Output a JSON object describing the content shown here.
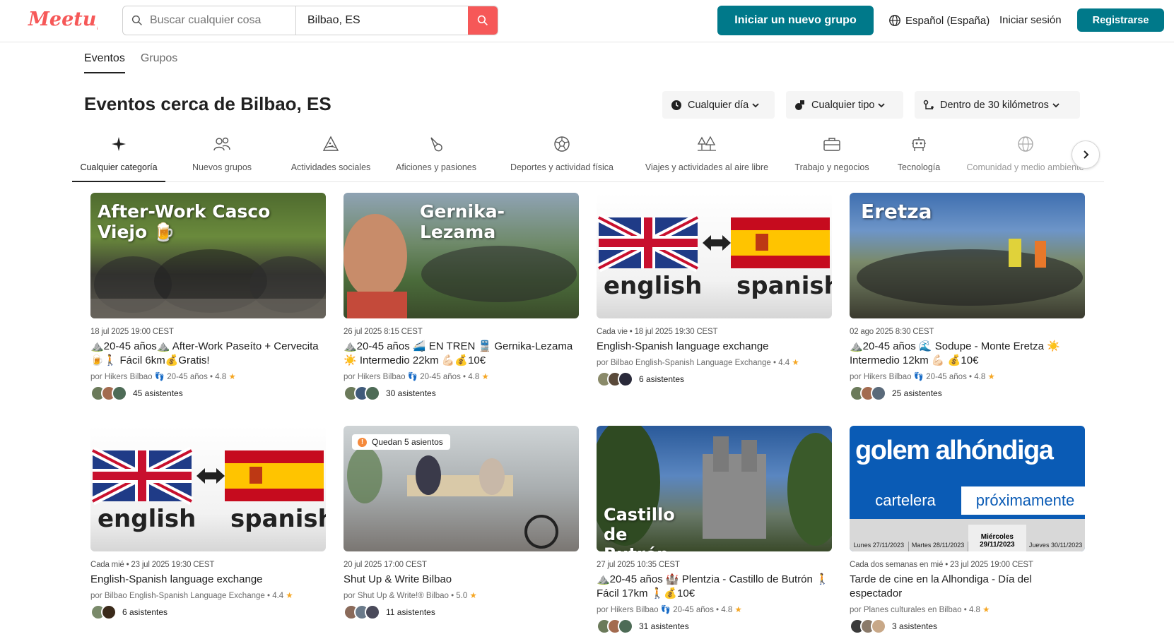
{
  "header": {
    "logo_text": "Meetup",
    "search_placeholder": "Buscar cualquier cosa",
    "location_value": "Bilbao, ES",
    "new_group_label": "Iniciar un nuevo grupo",
    "language_label": "Español (España)",
    "login_label": "Iniciar sesión",
    "register_label": "Registrarse",
    "colors": {
      "brand": "#f65858",
      "accent": "#00798a"
    }
  },
  "tabs": [
    {
      "label": "Eventos",
      "active": true
    },
    {
      "label": "Grupos",
      "active": false
    }
  ],
  "page_title": "Eventos cerca de Bilbao, ES",
  "filters": {
    "day": "Cualquier día",
    "type": "Cualquier tipo",
    "distance": "Dentro de 30 kilómetros"
  },
  "categories": [
    {
      "label": "Cualquier categoría",
      "icon": "sparkle-icon",
      "active": true
    },
    {
      "label": "Nuevos grupos",
      "icon": "people-icon"
    },
    {
      "label": "Actividades sociales",
      "icon": "pizza-icon"
    },
    {
      "label": "Aficiones y pasiones",
      "icon": "hobby-icon"
    },
    {
      "label": "Deportes y actividad física",
      "icon": "ball-icon"
    },
    {
      "label": "Viajes y actividades al aire libre",
      "icon": "trees-icon"
    },
    {
      "label": "Trabajo y negocios",
      "icon": "briefcase-icon"
    },
    {
      "label": "Tecnología",
      "icon": "robot-icon"
    },
    {
      "label": "Comunidad y medio ambiente",
      "icon": "globe-icon"
    }
  ],
  "events": [
    {
      "image_text": "After-Work Casco Viejo 🍺",
      "date": "18 jul 2025 19:00 CEST",
      "title": "⛰️20-45 años⛰️ After-Work Paseíto + Cervecita🍺🚶 Fácil 6km💰Gratis!",
      "org": "por Hikers Bilbao 👣 20-45 años • 4.8",
      "attendees": "45 asistentes"
    },
    {
      "image_text": "Gernika-Lezama",
      "date": "26 jul 2025 8:15 CEST",
      "title": "⛰️20-45 años 🚄 EN TREN 🚆 Gernika-Lezama ☀️ Intermedio 22km 💪🏻💰10€",
      "org": "por Hikers Bilbao 👣 20-45 años • 4.8",
      "attendees": "30 asistentes"
    },
    {
      "image_text_left": "english",
      "image_text_right": "spanish",
      "date": "Cada vie • 18 jul 2025 19:30 CEST",
      "title": "English-Spanish language exchange",
      "org": "por Bilbao English-Spanish Language Exchange • 4.4",
      "attendees": "6 asistentes"
    },
    {
      "image_text": "Eretza",
      "date": "02 ago 2025 8:30 CEST",
      "title": "⛰️20-45 años 🌊 Sodupe - Monte Eretza ☀️ Intermedio 12km 💪🏻 💰10€",
      "org": "por Hikers Bilbao 👣 20-45 años • 4.8",
      "attendees": "25 asistentes"
    },
    {
      "image_text_left": "english",
      "image_text_right": "spanish",
      "date": "Cada mié • 23 jul 2025 19:30 CEST",
      "title": "English-Spanish language exchange",
      "org": "por Bilbao English-Spanish Language Exchange • 4.4",
      "attendees": "6 asistentes"
    },
    {
      "badge": "Quedan 5 asientos",
      "date": "20 jul 2025 17:00 CEST",
      "title": "Shut Up & Write Bilbao",
      "org": "por Shut Up & Write!® Bilbao • 5.0",
      "attendees": "11 asistentes"
    },
    {
      "image_text": "Castillo de Butrón",
      "date": "27 jul 2025 10:35 CEST",
      "title": "⛰️20-45 años 🏰 Plentzia - Castillo de Butrón 🚶 Fácil 17km 🚶💰10€",
      "org": "por Hikers Bilbao 👣 20-45 años • 4.8",
      "attendees": "31 asistentes"
    },
    {
      "image_text": "golem alhóndiga",
      "image_sub_left": "cartelera",
      "image_sub_right": "próximamente",
      "image_days": [
        "Lunes 27/11/2023",
        "Martes 28/11/2023",
        "Miércoles 29/11/2023",
        "Jueves 30/11/2023"
      ],
      "date": "Cada dos semanas en mié • 23 jul 2025 19:00 CEST",
      "title": "Tarde de cine en la Alhondiga - Día del espectador",
      "org": "por Planes culturales en Bilbao • 4.8",
      "attendees": "3 asistentes"
    }
  ]
}
